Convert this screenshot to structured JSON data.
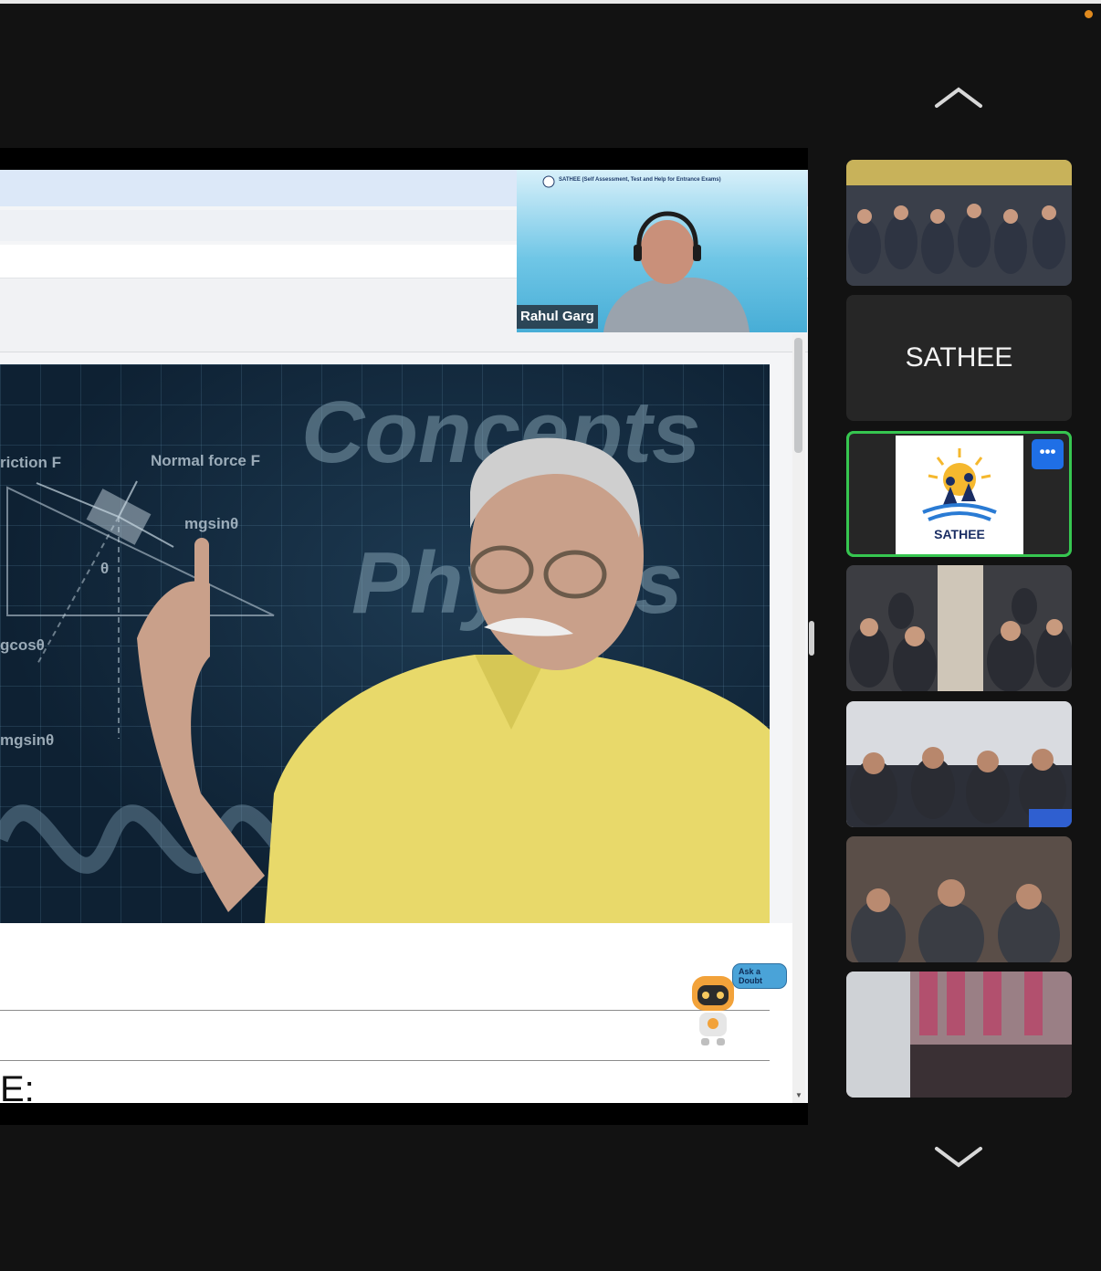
{
  "meeting": {
    "speaker_name": "Rahul Garg",
    "speaker_header": "SATHEE (Self Assessment, Test and Help for Entrance Exams)"
  },
  "shared_screen": {
    "video_words": {
      "concepts": "Concepts",
      "physics": "Physics"
    },
    "diagram_labels": {
      "friction": "riction F",
      "normal_force": "Normal force F",
      "mgsin_top": "mgsinθ",
      "theta": "θ",
      "mgcos": "gcosθ",
      "mgsin_bottom": "mgsinθ"
    },
    "ask_doubt_label": "Ask a Doubt",
    "page_heading_fragment": "E:"
  },
  "gallery": {
    "tiles": [
      {
        "kind": "video",
        "description": "classroom students"
      },
      {
        "kind": "name",
        "label": "SATHEE"
      },
      {
        "kind": "logo",
        "label": "SATHEE",
        "active_speaker": true
      },
      {
        "kind": "video",
        "description": "classroom students"
      },
      {
        "kind": "video",
        "description": "classroom students"
      },
      {
        "kind": "video",
        "description": "classroom students"
      },
      {
        "kind": "video",
        "description": "classroom"
      }
    ],
    "more_options_label": "•••"
  },
  "colors": {
    "background": "#121212",
    "active_border": "#36c650",
    "more_button": "#1f6fe6",
    "record_indicator": "#e08a1e"
  }
}
